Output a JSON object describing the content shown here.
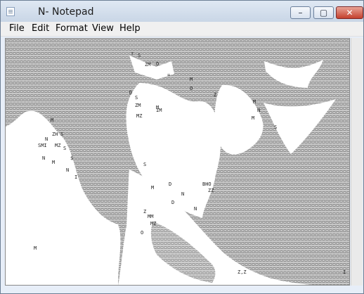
{
  "window": {
    "title": "N- Notepad"
  },
  "controls": {
    "minimize": "–",
    "maximize": "▢",
    "close": "✕"
  },
  "menu": {
    "file": "File",
    "edit": "Edit",
    "format": "Format",
    "view": "View",
    "help": "Help"
  },
  "editor": {
    "fragments": [
      "?",
      "S",
      "ZM",
      "O",
      "=",
      "M",
      "D",
      "S",
      "ZM",
      "M",
      "Z",
      "IM",
      "MZ",
      "O",
      "M",
      "N",
      "M",
      "S",
      "M",
      "ZH",
      "S",
      "N",
      "MZ",
      "S",
      "$",
      "SMI",
      "N",
      "M",
      "N",
      "I",
      "D",
      "S",
      "M",
      "N",
      "ZZ",
      "BHO",
      "D",
      "N",
      "Z",
      "MM",
      "MZ",
      "O",
      "M",
      "Z,Z",
      "I"
    ]
  }
}
